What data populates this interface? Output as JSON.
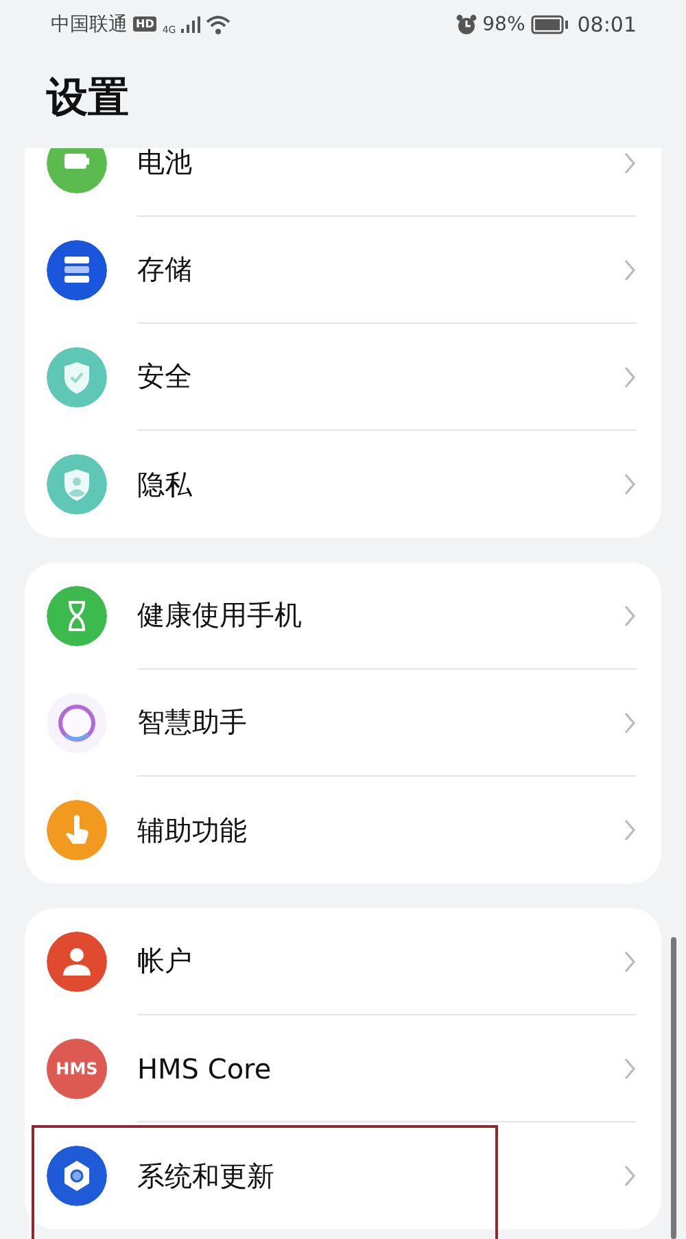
{
  "status_bar": {
    "carrier": "中国联通",
    "hd_badge": "HD",
    "network": "4G",
    "battery_percent": "98%",
    "time": "08:01"
  },
  "title": "设置",
  "groups": [
    {
      "items": [
        {
          "kind": "battery",
          "label": "电池",
          "highlighted": false
        },
        {
          "kind": "storage",
          "label": "存储",
          "highlighted": false
        },
        {
          "kind": "security",
          "label": "安全",
          "highlighted": false
        },
        {
          "kind": "privacy",
          "label": "隐私",
          "highlighted": false
        }
      ]
    },
    {
      "items": [
        {
          "kind": "health",
          "label": "健康使用手机",
          "highlighted": false
        },
        {
          "kind": "assistant",
          "label": "智慧助手",
          "highlighted": false
        },
        {
          "kind": "accessibility",
          "label": "辅助功能",
          "highlighted": false
        }
      ]
    },
    {
      "items": [
        {
          "kind": "account",
          "label": "帐户",
          "highlighted": false
        },
        {
          "kind": "hms",
          "icon_text": "HMS",
          "label": "HMS Core",
          "highlighted": false
        },
        {
          "kind": "system",
          "label": "系统和更新",
          "highlighted": true
        }
      ]
    }
  ]
}
